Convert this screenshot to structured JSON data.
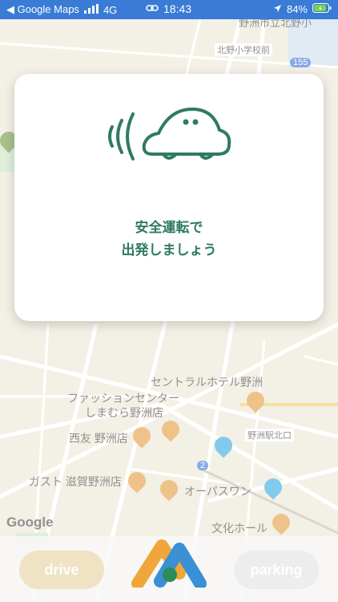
{
  "status_bar": {
    "back_app": "◀ Google Maps",
    "network": "4G",
    "time": "18:43",
    "battery": "84%"
  },
  "map": {
    "labels": {
      "school": "北野小学校前",
      "route_155": "155",
      "route_2": "2",
      "hotel": "セントラルホテル野洲",
      "fashion_1": "ファッションセンター",
      "fashion_2": "しまむら野洲店",
      "nishitomo": "西友 野洲店",
      "station": "野洲駅北口",
      "gusto": "ガスト 滋賀野洲店",
      "opas": "オーパスワン",
      "culture": "文化ホール",
      "top_partial": "野洲市立北野小"
    },
    "attribution": "Google"
  },
  "dialog": {
    "message_line1": "安全運転で",
    "message_line2": "出発しましょう"
  },
  "bottom_bar": {
    "drive_label": "drive",
    "parking_label": "parking"
  },
  "colors": {
    "accent": "#2f7a64",
    "status_bar": "#3a7bd5"
  }
}
